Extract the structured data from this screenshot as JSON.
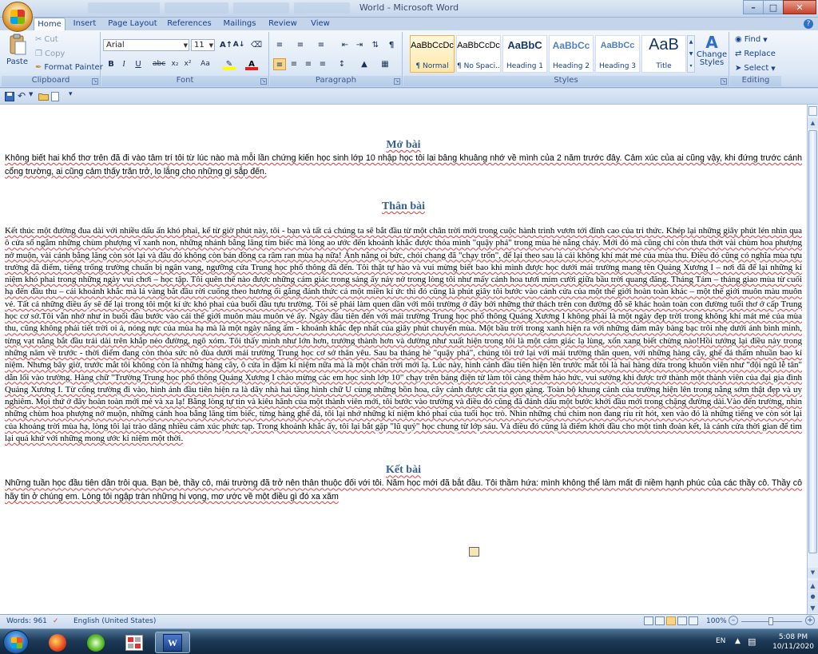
{
  "window": {
    "title": "World - Microsoft Word"
  },
  "tabs": [
    "Home",
    "Insert",
    "Page Layout",
    "References",
    "Mailings",
    "Review",
    "View"
  ],
  "ribbon": {
    "clipboard": {
      "label": "Clipboard",
      "paste": "Paste",
      "cut": "Cut",
      "copy": "Copy",
      "format_painter": "Format Painter"
    },
    "font": {
      "label": "Font",
      "font_name": "Arial",
      "font_size": "11"
    },
    "paragraph": {
      "label": "Paragraph"
    },
    "styles": {
      "label": "Styles",
      "items": [
        {
          "sample": "AaBbCcDc",
          "name": "¶ Normal"
        },
        {
          "sample": "AaBbCcDc",
          "name": "¶ No Spaci..."
        },
        {
          "sample": "AaBbC",
          "name": "Heading 1"
        },
        {
          "sample": "AaBbCc",
          "name": "Heading 2"
        },
        {
          "sample": "AaBbCc",
          "name": "Heading 3"
        },
        {
          "sample": "AaB",
          "name": "Title"
        }
      ],
      "change_styles": "Change Styles"
    },
    "editing": {
      "label": "Editing",
      "find": "Find",
      "replace": "Replace",
      "select": "Select"
    }
  },
  "document": {
    "h1": "Mở bài",
    "p1": "Không biết hai khổ thơ trên đã đi vào tâm trí tôi từ lúc nào mà mỗi lần chứng kiến học sinh lớp 10 nhập học tôi lại bâng khuâng nhớ về mình của 2 năm trước đây. Cảm xúc của ai cũng vậy, khi đứng trước cánh cổng trường, ai cũng cảm thấy trăn trở, lo lắng cho những gì sắp đến.",
    "h2": "Thân bài",
    "p2": "Kết thúc một đường đua dài với nhiều dấu ấn khó phai, kể từ giờ phút này, tôi - bạn và tất cả chúng ta sẽ bắt đầu từ một chân trời mới trong cuộc hành trình vươn tới đỉnh cao của tri thức. Khép lại những giây phút lén nhìn qua ô cửa sổ ngắm những chùm phượng vĩ xanh non, những nhánh bằng lăng tím biếc mà lòng ao ước đến khoảnh khắc được thỏa mình \"quậy phá\" trong mùa hè nắng cháy. Mới đó mà cũng chỉ còn thưa thớt vài chùm hoa phượng nở muộn, vài cánh bằng lăng còn sót lại và đâu đó không còn bản đồng ca râm ran mùa hạ nữa! Ánh nắng oi bức, chói chang đã \"chạy trốn\", để lại theo sau là cái không khí mát mẻ của mùa thu. Điều đó cũng có nghĩa mùa tựu trường đã điểm, tiếng trống trường chuẩn bị ngân vang, ngưỡng cửa Trung học phổ thông đã đến. Tôi thật tự hào và vui mừng biết bao khi mình được học dưới mái trường mang tên Quảng Xương I – nơi đã để lại những kỉ niệm khó phai trong những ngày vui chơi – học tập. Tôi quên thế nào được những cảm giác trong sáng ấy nảy nở trong lòng tôi như mấy cánh hoa tươi mỉm cười giữa bầu trời quang đãng. Tháng Tám – tháng giao mùa từ cuối hạ đến đầu thu – cái khoảnh khắc mà lá vàng bắt đầu rời cuống theo hương ổi gắng đánh thức cả một miền kí ức thì đó cũng là phút giây tôi bước vào cánh cửa của một thế giới hoàn toàn khác – một thế giới muôn màu muôn vẻ. Tất cả những điều ấy sẽ để lại trong tôi một kí ức khó phai của buổi đầu tựu trường. Tôi sẽ phải làm quen dần với môi trường ở đây bởi những thử thách trên con đường đỗ sẽ khác hoàn toàn con đường tuổi thơ ở cấp Trung học cơ sở.Tôi vẫn nhớ như in buổi đầu bước vào cái thế giới muôn màu muôn vẻ ấy. Ngày đầu tiên đến với mái trường Trung học phổ thông Quảng Xương I không phải là một ngày đẹp trời trong không khí mát mẻ của mùa thu, cũng không phải tiết trời oi ả, nóng nực của mùa hạ mà là một ngày nắng ấm - khoảnh khắc đẹp nhất của giây phút chuyển mùa. Một bầu trời trong xanh hiện ra với những đám mây bàng bạc trôi nhẹ dưới ánh bình minh, từng vạt nắng bắt đầu trải dài trên khắp nẻo đường, ngõ xóm. Tôi thấy mình như lớn hơn, trưởng thành hơn và dường như xuất hiện trong tôi là một cảm giác lạ lùng, xốn xang biết chừng nào!Hồi tưởng lại điều này trong những năm về trước - thời điểm đang còn thỏa sức nô đùa dưới mái trường Trung học cơ sở thân yêu. Sau ba tháng hè \"quậy phá\", chúng tôi trở lại với mái trường thân quen, với những hàng cây, ghế đá thấm nhuần bao kỉ niệm. Nhưng bây giờ, trước mắt tôi không còn là những hàng cây, ô cửa in đậm kỉ niệm nữa mà là một chân trời mới lạ. Lúc này, hình cảnh đầu tiên hiện lên trước mắt tôi là hai hàng dừa trong khuôn viên như \"đội ngũ lễ tân\" dẫn lối vào trường. Hàng chữ \"Trường Trung học phổ thông Quảng Xương I chào mừng các em học sinh lớp 10\" chạy trên bảng điện tử làm tôi càng thêm háo hức, vui sướng khi được trở thành một thành viên của đại gia đình Quảng Xương I. Từ cổng trường đi vào, hình ảnh đầu tiên hiện ra là dãy nhà hai tầng hình chữ U cùng những bồn hoa, cây cảnh được cắt tỉa gọn gàng. Toàn bộ khung cảnh của trường hiện lên trong nắng sớm thật đẹp và uy nghiêm. Mọi thứ ở đây hoàn toàn mới mẻ và xa lạ! Bằng lòng tự tin và kiêu hãnh của một thành viên mới, tôi bước vào trường và điều đó cũng đã đánh dấu một bước khởi đầu mới trong chặng đường dài.Vào đến trường, nhìn những chùm hoa phượng nở muộn, những cánh hoa bằng lăng tím biếc, từng hàng ghế đá, tôi lại nhớ những kỉ niệm khó phai của tuổi học trò. Nhìn những chú chim non đang ríu rít hót, xen vào đó là những tiếng ve còn sót lại của khoảng trời mùa hạ, lòng tôi lại trào dâng nhiều cảm xúc phức tạp. Trong khoảnh khắc ấy, tôi lại bắt gặp \"lũ quỷ\" học chung từ lớp sáu. Và điều đó cũng là điểm khởi đầu cho một tình đoàn kết, là cánh cửa thời gian để tìm lại quá khứ với những mong ước kỉ niệm một thời.",
    "h3": "Kết bài",
    "p3": "Những tuần học đầu tiên dần trôi qua. Bạn bè, thầy cô, mái trường đã trở nên thân thuộc đối với tôi. Năm học mới đã bắt đầu. Tôi thầm hứa: mình không thể làm mất đi niềm hạnh phúc của các thầy cô. Thầy cô hãy tin ở chúng em. Lòng tôi ngập tràn những hi vọng, mơ ước về một điều gì đó xa xăm"
  },
  "status": {
    "words": "Words: 961",
    "language": "English (United States)",
    "zoom": "100%"
  },
  "tray": {
    "lang": "EN",
    "time": "5:08 PM",
    "date": "10/11/2020"
  }
}
